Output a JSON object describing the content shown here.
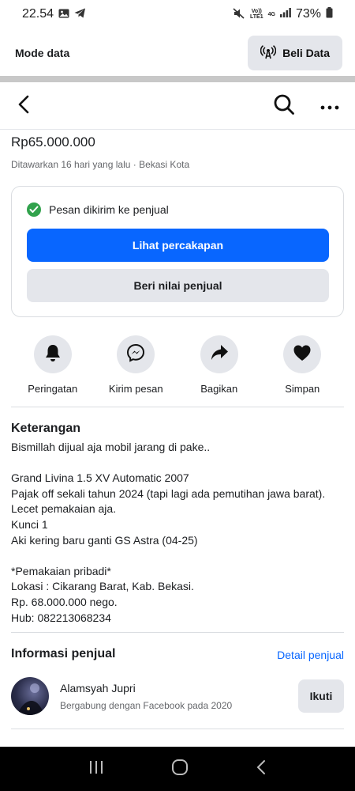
{
  "status_bar": {
    "time": "22.54",
    "battery": "73%",
    "network_top": "Vo))",
    "network_bottom": "LTE1",
    "gen": "4G"
  },
  "mode_bar": {
    "label": "Mode data",
    "button": "Beli Data"
  },
  "listing": {
    "price": "Rp65.000.000",
    "meta": "Ditawarkan 16 hari yang lalu · Bekasi Kota"
  },
  "message_card": {
    "status": "Pesan dikirim ke penjual",
    "primary_button": "Lihat percakapan",
    "secondary_button": "Beri nilai penjual"
  },
  "actions": [
    {
      "label": "Peringatan",
      "icon": "bell-icon"
    },
    {
      "label": "Kirim pesan",
      "icon": "messenger-icon"
    },
    {
      "label": "Bagikan",
      "icon": "share-icon"
    },
    {
      "label": "Simpan",
      "icon": "heart-icon"
    }
  ],
  "description": {
    "title": "Keterangan",
    "text": "Bismillah dijual aja mobil jarang di pake..\n\nGrand Livina 1.5 XV Automatic 2007\nPajak off sekali tahun 2024 (tapi lagi ada pemutihan jawa barat).\nLecet pemakaian aja.\nKunci 1\nAki kering baru ganti GS Astra (04-25)\n\n*Pemakaian pribadi*\nLokasi : Cikarang Barat, Kab. Bekasi.\nRp. 68.000.000 nego.\nHub: 082213068234"
  },
  "seller_info": {
    "title": "Informasi penjual",
    "detail_link": "Detail penjual",
    "name": "Alamsyah Jupri",
    "joined": "Bergabung dengan Facebook pada 2020",
    "follow_button": "Ikuti"
  },
  "colors": {
    "accent": "#0866ff",
    "success": "#31a24c",
    "button_gray": "#e4e6eb"
  }
}
